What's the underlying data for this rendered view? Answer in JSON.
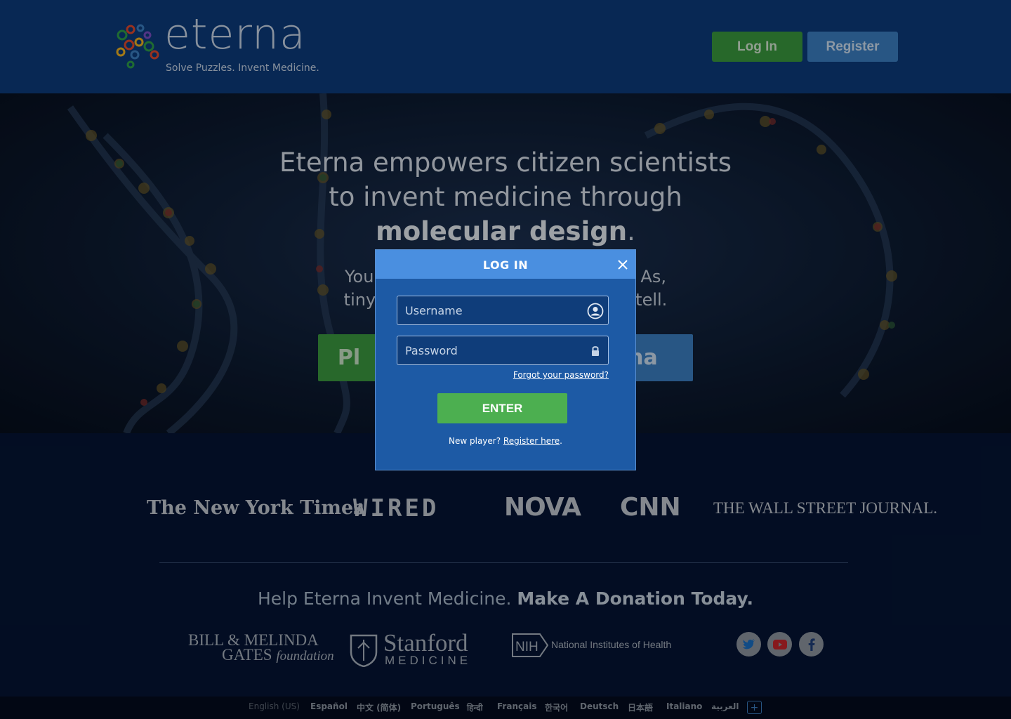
{
  "header": {
    "logo_word": "eterna",
    "tagline": "Solve Puzzles. Invent Medicine.",
    "login_label": "Log In",
    "register_label": "Register"
  },
  "hero": {
    "title_line1": "Eterna empowers citizen scientists",
    "title_line2": "to invent medicine through",
    "title_bold": "molecular design",
    "title_end": ".",
    "sub_left1": "You",
    "sub_right1": "As,",
    "sub_left2": "tiny",
    "sub_right2": "tell.",
    "play_visible": "Pl",
    "about_visible": "rna"
  },
  "press": {
    "nyt": "The New York Times",
    "wired": "WIRED",
    "nova": "NOVA",
    "cnn": "CNN",
    "wsj": "THE WALL STREET JOURNAL."
  },
  "donate": {
    "text": "Help Eterna Invent Medicine. ",
    "bold": "Make A Donation Today."
  },
  "sponsors": {
    "gates_line1": "BILL & MELINDA",
    "gates_line2": "GATES",
    "gates_foundation": "foundation",
    "stanford_line1": "Stanford",
    "stanford_line2": "MEDICINE",
    "nih_abbr": "NIH",
    "nih_name": "National Institutes of Health"
  },
  "social": [
    "twitter-icon",
    "youtube-icon",
    "facebook-icon"
  ],
  "languages": [
    "English (US)",
    "Español",
    "中文 (简体)",
    "Português",
    "हिन्दी",
    "Français",
    "한국어",
    "Deutsch",
    "日本語",
    "Italiano",
    "العربية"
  ],
  "lang_more": "+",
  "modal": {
    "title": "LOG IN",
    "username_placeholder": "Username",
    "password_placeholder": "Password",
    "forgot": "Forgot your password?",
    "enter": "ENTER",
    "new_player": "New player? ",
    "register_here": "Register here",
    "period": "."
  },
  "colors": {
    "header_bg": "#0c3b7c",
    "page_bg": "#051434",
    "green": "#4caf50",
    "blue": "#3b7fc3",
    "modal_bg": "#1d5aa5",
    "modal_head": "#4a8fe0"
  }
}
